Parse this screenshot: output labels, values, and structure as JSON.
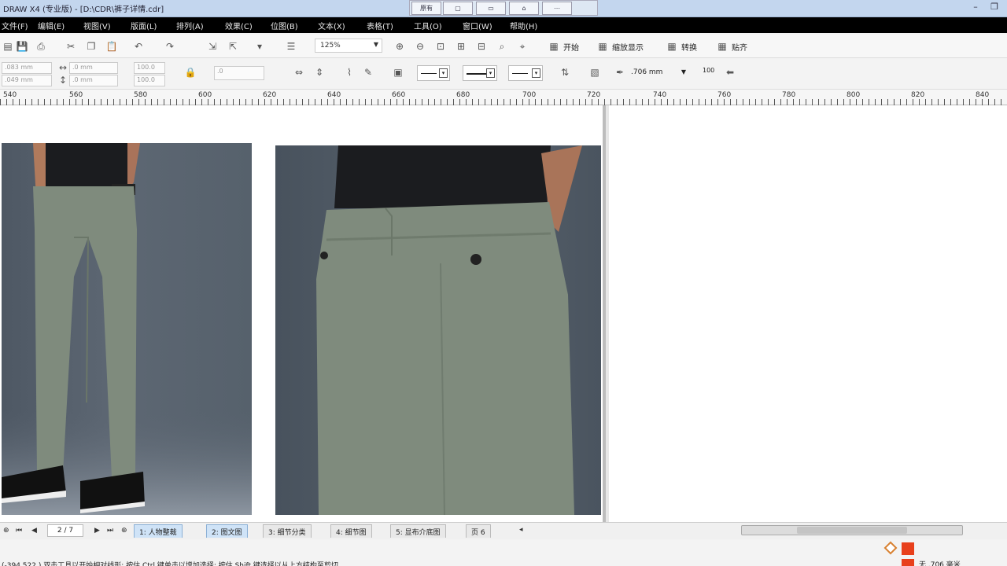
{
  "window": {
    "title": "DRAW X4 (专业版) - [D:\\CDR\\裤子详情.cdr]",
    "mini_buttons": [
      "原有",
      "",
      "",
      "",
      ""
    ]
  },
  "menu": {
    "items": [
      "文件(F)",
      "编辑(E)",
      "视图(V)",
      "版面(L)",
      "排列(A)",
      "效果(C)",
      "位图(B)",
      "文本(X)",
      "表格(T)",
      "工具(O)",
      "窗口(W)",
      "帮助(H)"
    ]
  },
  "toolbar": {
    "zoom": "125%",
    "labels": [
      "开始",
      "缩放显示",
      "转换",
      "贴齐"
    ]
  },
  "property_bar": {
    "x": ".083 mm",
    "y": ".049 mm",
    "w": ".0 mm",
    "h": ".0 mm",
    "scale_x": "100.0",
    "scale_y": "100.0",
    "angle": ".0",
    "outline_width": ".706 mm",
    "percent": "100"
  },
  "ruler": {
    "labels": [
      "540",
      "560",
      "580",
      "600",
      "620",
      "640",
      "660",
      "680",
      "700",
      "720",
      "740",
      "760",
      "780",
      "800",
      "820",
      "840"
    ]
  },
  "page_nav": {
    "indicator": "2 / 7",
    "tabs": [
      "1: 人物整裁",
      "2: 图文图",
      "3: 细节分类",
      "4: 细节图",
      "5: 显布介底图",
      "页 6"
    ],
    "active_tab": 1
  },
  "status": {
    "coords": "(-394.522 ) 双击工具以开始相对线形; 按住 Ctrl 键单击以增加选择; 按住 Shift 键选择以从上方结构至剪切",
    "outline": "无 .706 毫米"
  },
  "colors": {
    "fill": "#e8401c",
    "outline": "#e8401c",
    "pants": "#7f8b7d",
    "shirt": "#1b1c1f",
    "background": "#56606b"
  }
}
